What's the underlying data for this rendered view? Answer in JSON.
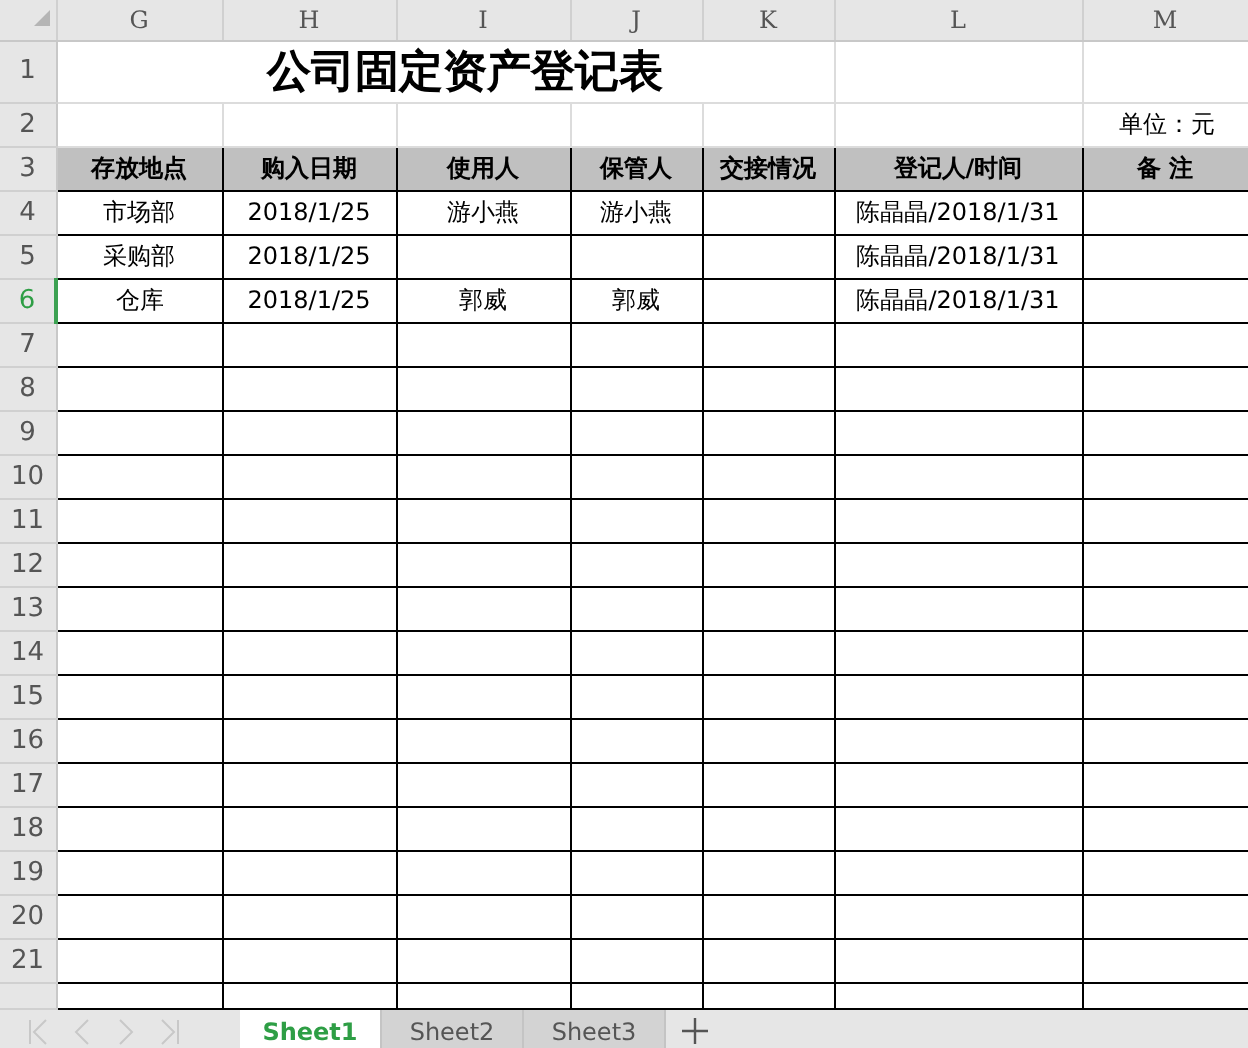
{
  "columns": [
    "G",
    "H",
    "I",
    "J",
    "K",
    "L",
    "M"
  ],
  "rows": [
    {
      "number": "1",
      "selected": false,
      "kind": "title",
      "text": "公司固定资产登记表"
    },
    {
      "number": "2",
      "selected": false,
      "kind": "unit",
      "text": "单位：元"
    },
    {
      "number": "3",
      "selected": false,
      "kind": "header",
      "cells": [
        "存放地点",
        "购入日期",
        "使用人",
        "保管人",
        "交接情况",
        "登记人/时间",
        "备  注"
      ]
    },
    {
      "number": "4",
      "selected": false,
      "kind": "data",
      "cells": {
        "G": "市场部",
        "H": "2018/1/25",
        "I": "游小燕",
        "J": "游小燕",
        "L": "陈晶晶/2018/1/31"
      }
    },
    {
      "number": "5",
      "selected": false,
      "kind": "data",
      "cells": {
        "G": "采购部",
        "H": "2018/1/25",
        "L": "陈晶晶/2018/1/31"
      }
    },
    {
      "number": "6",
      "selected": true,
      "kind": "data",
      "cells": {
        "G": "仓库",
        "H": "2018/1/25",
        "I": "郭威",
        "J": "郭威",
        "L": "陈晶晶/2018/1/31"
      }
    },
    {
      "number": "7",
      "selected": false,
      "kind": "empty"
    },
    {
      "number": "8",
      "selected": false,
      "kind": "empty"
    },
    {
      "number": "9",
      "selected": false,
      "kind": "empty"
    },
    {
      "number": "10",
      "selected": false,
      "kind": "empty"
    },
    {
      "number": "11",
      "selected": false,
      "kind": "empty"
    },
    {
      "number": "12",
      "selected": false,
      "kind": "empty"
    },
    {
      "number": "13",
      "selected": false,
      "kind": "empty"
    },
    {
      "number": "14",
      "selected": false,
      "kind": "empty"
    },
    {
      "number": "15",
      "selected": false,
      "kind": "empty"
    },
    {
      "number": "16",
      "selected": false,
      "kind": "empty"
    },
    {
      "number": "17",
      "selected": false,
      "kind": "empty"
    },
    {
      "number": "18",
      "selected": false,
      "kind": "empty"
    },
    {
      "number": "19",
      "selected": false,
      "kind": "empty"
    },
    {
      "number": "20",
      "selected": false,
      "kind": "empty"
    },
    {
      "number": "21",
      "selected": false,
      "kind": "empty"
    }
  ],
  "sheet_tabs": [
    {
      "label": "Sheet1",
      "selected": true
    },
    {
      "label": "Sheet2",
      "selected": false
    },
    {
      "label": "Sheet3",
      "selected": false
    }
  ]
}
